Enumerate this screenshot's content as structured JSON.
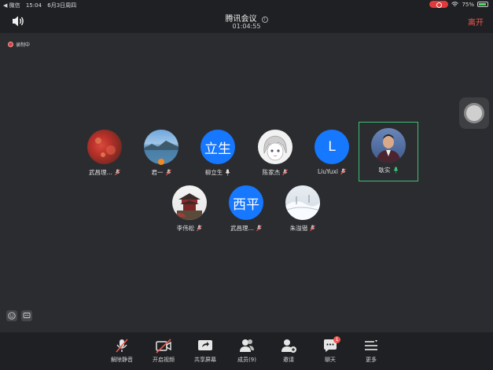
{
  "status_bar": {
    "carrier": "◀ 微信",
    "time": "15:04",
    "date": "6月3日周四",
    "battery": "75%"
  },
  "header": {
    "title": "腾讯会议",
    "timer": "01:04:55",
    "leave_label": "离开",
    "info_icon": "info-icon",
    "speaker_icon": "speaker-icon"
  },
  "recording": {
    "label": "录制中"
  },
  "participants": [
    {
      "name": "武昌理…",
      "avatar_text": "",
      "avatar_type": "photo-red-leaves",
      "mic": "muted"
    },
    {
      "name": "君一",
      "avatar_text": "",
      "avatar_type": "photo-lake",
      "mic": "muted"
    },
    {
      "name": "柳立生",
      "avatar_text": "立生",
      "avatar_type": "initials",
      "mic": "on"
    },
    {
      "name": "陈家杰",
      "avatar_text": "",
      "avatar_type": "photo-anime",
      "mic": "muted"
    },
    {
      "name": "LiuYuxi",
      "avatar_text": "L",
      "avatar_type": "initials",
      "mic": "muted"
    },
    {
      "name": "耿实",
      "avatar_text": "",
      "avatar_type": "photo-person",
      "mic": "speaking",
      "active": true
    },
    {
      "name": "李伟松",
      "avatar_text": "",
      "avatar_type": "photo-building",
      "mic": "muted"
    },
    {
      "name": "武昌理…",
      "avatar_text": "西平",
      "avatar_type": "initials",
      "mic": "muted"
    },
    {
      "name": "朱溢锴",
      "avatar_text": "",
      "avatar_type": "photo-snow",
      "mic": "muted"
    }
  ],
  "toolbar": {
    "items": [
      {
        "label": "解除静音",
        "icon": "mic-off-icon"
      },
      {
        "label": "开启视频",
        "icon": "video-off-icon"
      },
      {
        "label": "共享屏幕",
        "icon": "share-screen-icon"
      },
      {
        "label": "成员(9)",
        "icon": "members-icon"
      },
      {
        "label": "邀请",
        "icon": "invite-icon"
      },
      {
        "label": "聊天",
        "icon": "chat-icon",
        "badge": "1"
      },
      {
        "label": "更多",
        "icon": "more-icon"
      }
    ]
  },
  "colors": {
    "accent_blue": "#1677ff",
    "leave_red": "#f2574e",
    "active_green": "#3fbf74",
    "background": "#2b2c30"
  }
}
